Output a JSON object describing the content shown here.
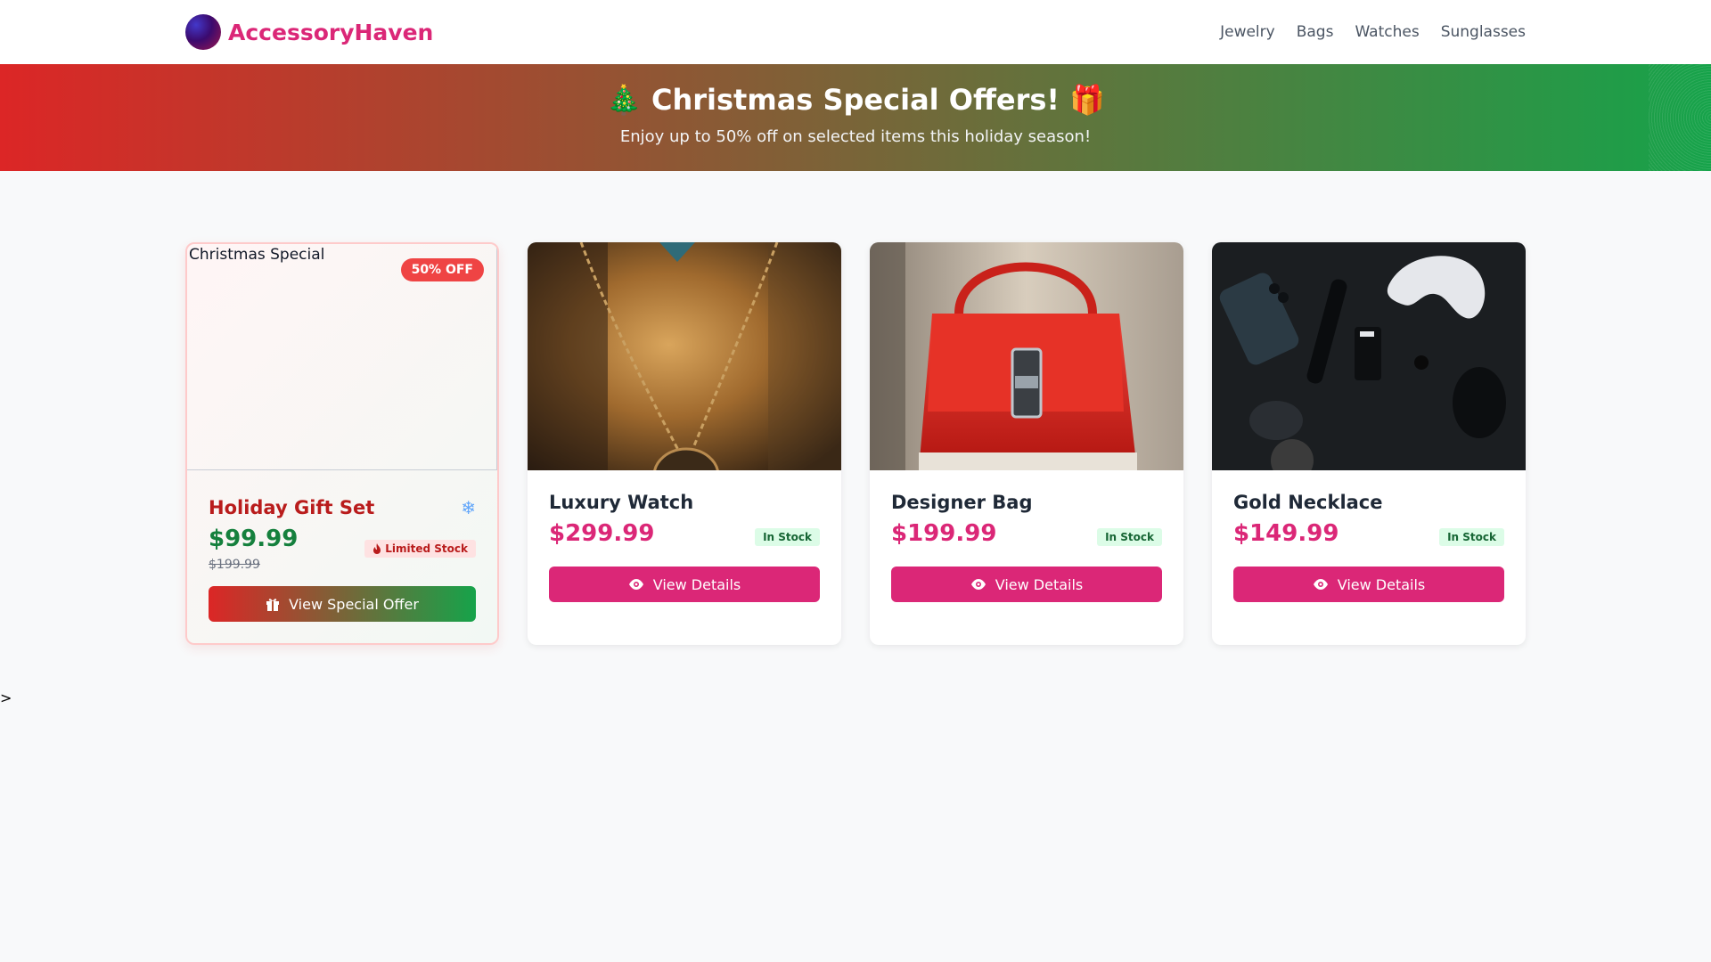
{
  "brand": {
    "name": "AccessoryHaven"
  },
  "nav": {
    "links": [
      "Jewelry",
      "Bags",
      "Watches",
      "Sunglasses"
    ]
  },
  "banner": {
    "title": "🎄 Christmas Special Offers! 🎁",
    "subtitle": "Enjoy up to 50% off on selected items this holiday season!"
  },
  "special": {
    "image_alt": "Christmas Special",
    "discount": "50% OFF",
    "name": "Holiday Gift Set",
    "icon": "snowflake-icon",
    "price": "$99.99",
    "old_price": "$199.99",
    "stock": "Limited Stock",
    "button": "View Special Offer"
  },
  "products": [
    {
      "name": "Luxury Watch",
      "price": "$299.99",
      "stock": "In Stock",
      "button": "View Details",
      "image": "necklace-photo"
    },
    {
      "name": "Designer Bag",
      "price": "$199.99",
      "stock": "In Stock",
      "button": "View Details",
      "image": "red-bag-photo"
    },
    {
      "name": "Gold Necklace",
      "price": "$149.99",
      "stock": "In Stock",
      "button": "View Details",
      "image": "gadgets-photo"
    }
  ],
  "stray_text": ">",
  "colors": {
    "brand": "#db2777",
    "banner_start": "#dc2626",
    "banner_end": "#16a34a",
    "stock_bg": "#dcfce7",
    "special_price": "#15803d"
  }
}
